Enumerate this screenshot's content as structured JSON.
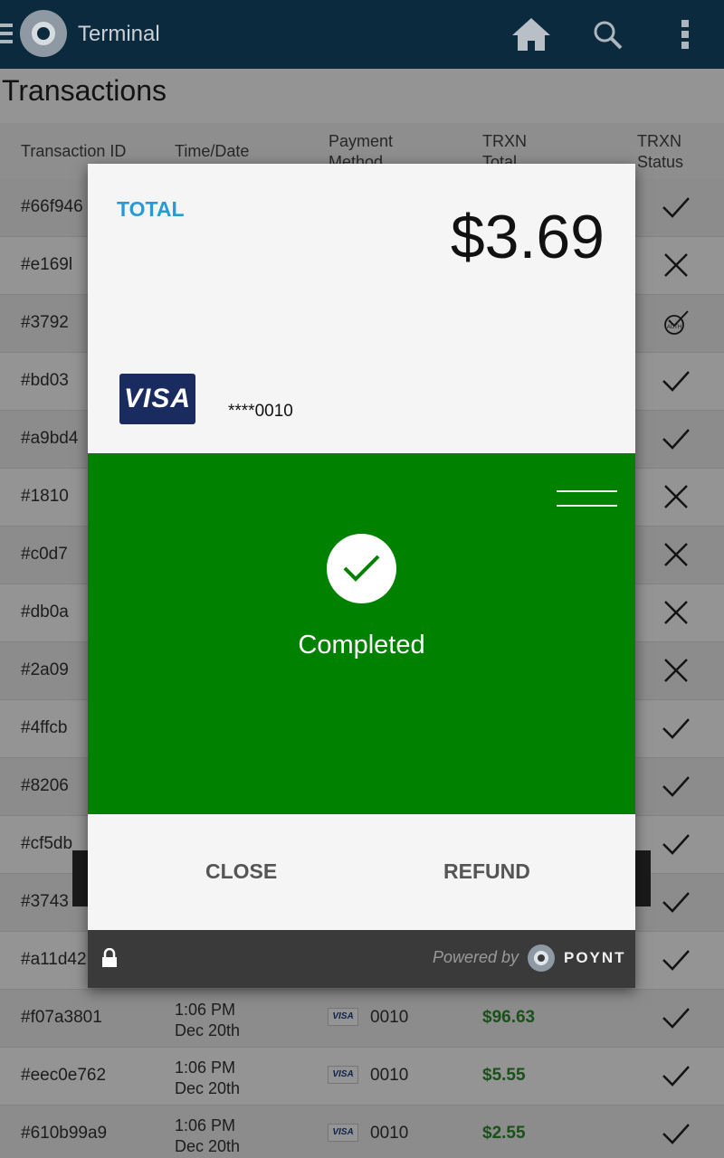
{
  "appbar": {
    "title": "Terminal",
    "icons": [
      "menu-icon",
      "app-logo",
      "home-icon",
      "search-icon",
      "more-vert-icon"
    ]
  },
  "page": {
    "title": "Transactions"
  },
  "table": {
    "headers": {
      "id": "Transaction ID",
      "time": "Time/Date",
      "payment": "Payment\nMethod",
      "total": "TRXN\nTotal",
      "status": "TRXN\nStatus"
    },
    "rows": [
      {
        "id": "#66f946",
        "time": "",
        "date": "",
        "card": "",
        "last4": "",
        "total": "",
        "status": "check"
      },
      {
        "id": "#e169l",
        "time": "",
        "date": "",
        "card": "",
        "last4": "",
        "total": "",
        "status": "cross"
      },
      {
        "id": "#3792",
        "time": "",
        "date": "",
        "card": "",
        "last4": "",
        "total": "",
        "status": "auth"
      },
      {
        "id": "#bd03",
        "time": "",
        "date": "",
        "card": "",
        "last4": "",
        "total": "",
        "status": "check"
      },
      {
        "id": "#a9bd4",
        "time": "",
        "date": "",
        "card": "",
        "last4": "",
        "total": "",
        "status": "check"
      },
      {
        "id": "#1810",
        "time": "",
        "date": "",
        "card": "",
        "last4": "",
        "total": "",
        "status": "cross"
      },
      {
        "id": "#c0d7",
        "time": "",
        "date": "",
        "card": "",
        "last4": "",
        "total": "",
        "status": "cross"
      },
      {
        "id": "#db0a",
        "time": "",
        "date": "",
        "card": "",
        "last4": "",
        "total": "",
        "status": "cross"
      },
      {
        "id": "#2a09",
        "time": "",
        "date": "",
        "card": "",
        "last4": "",
        "total": "",
        "status": "cross"
      },
      {
        "id": "#4ffcb",
        "time": "",
        "date": "",
        "card": "",
        "last4": "",
        "total": "",
        "status": "check"
      },
      {
        "id": "#8206",
        "time": "",
        "date": "",
        "card": "",
        "last4": "",
        "total": "",
        "status": "check"
      },
      {
        "id": "#cf5db",
        "time": "",
        "date": "",
        "card": "",
        "last4": "",
        "total": "",
        "status": "check"
      },
      {
        "id": "#3743",
        "time": "",
        "date": "",
        "card": "",
        "last4": "",
        "total": "",
        "status": "check"
      },
      {
        "id": "#a11d42",
        "time": "",
        "date": "",
        "card": "",
        "last4": "",
        "total": "",
        "status": "check"
      },
      {
        "id": "#f07a3801",
        "time": "1:06 PM",
        "date": "Dec 20th",
        "card": "VISA",
        "last4": "0010",
        "total": "$96.63",
        "status": "check"
      },
      {
        "id": "#eec0e762",
        "time": "1:06 PM",
        "date": "Dec 20th",
        "card": "VISA",
        "last4": "0010",
        "total": "$5.55",
        "status": "check"
      },
      {
        "id": "#610b99a9",
        "time": "1:06 PM",
        "date": "Dec 20th",
        "card": "VISA",
        "last4": "0010",
        "total": "$2.55",
        "status": "check"
      }
    ]
  },
  "dialog": {
    "total_label": "TOTAL",
    "total_amount": "$3.69",
    "card_brand": "VISA",
    "card_masked": "****0010",
    "status_text": "Completed",
    "close_label": "CLOSE",
    "refund_label": "REFUND",
    "powered_by": "Powered by",
    "brand": "POYNT"
  },
  "colors": {
    "appbar": "#0b2a3d",
    "success_green": "#008200",
    "total_label_blue": "#2a9ad6",
    "amount_green": "#2e8b2e"
  }
}
